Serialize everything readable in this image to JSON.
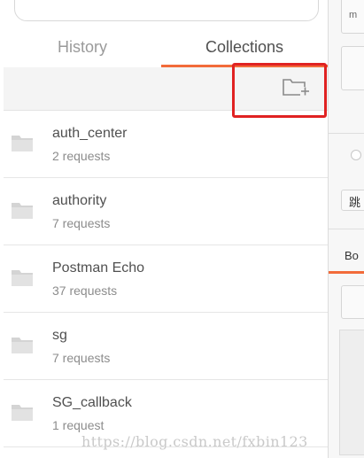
{
  "tabs": {
    "history": "History",
    "collections": "Collections"
  },
  "toolbar": {
    "new_collection_icon": "folder-plus-icon"
  },
  "collections": [
    {
      "name": "auth_center",
      "count": "2 requests"
    },
    {
      "name": "authority",
      "count": "7 requests"
    },
    {
      "name": "Postman Echo",
      "count": "37 requests"
    },
    {
      "name": "sg",
      "count": "7 requests"
    },
    {
      "name": "SG_callback",
      "count": "1 request"
    }
  ],
  "right_panel": {
    "fragment_top": "m",
    "fragment_mid": "跳",
    "fragment_tab": "Bo"
  },
  "colors": {
    "accent": "#f26b3a",
    "highlight": "#e02222"
  },
  "watermark": "https://blog.csdn.net/fxbin123"
}
